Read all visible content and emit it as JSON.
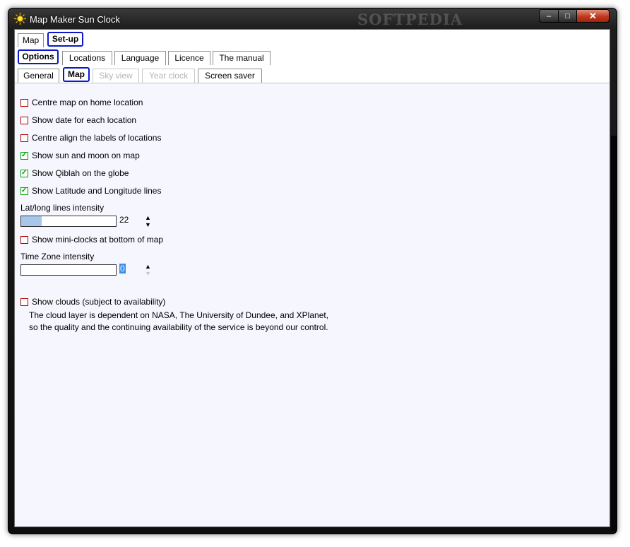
{
  "window": {
    "title": "Map Maker Sun Clock",
    "watermark": "SOFTPEDIA",
    "controls": {
      "minimize": "–",
      "maximize": "□",
      "close": "✕"
    }
  },
  "tabs_main": [
    {
      "label": "Map",
      "active": false
    },
    {
      "label": "Set-up",
      "active": true
    }
  ],
  "tabs_setup": [
    {
      "label": "Options",
      "active": true
    },
    {
      "label": "Locations",
      "active": false
    },
    {
      "label": "Language",
      "active": false
    },
    {
      "label": "Licence",
      "active": false
    },
    {
      "label": "The manual",
      "active": false
    }
  ],
  "tabs_options": [
    {
      "label": "General",
      "active": false,
      "enabled": true
    },
    {
      "label": "Map",
      "active": true,
      "enabled": true
    },
    {
      "label": "Sky view",
      "active": false,
      "enabled": false
    },
    {
      "label": "Year clock",
      "active": false,
      "enabled": false
    },
    {
      "label": "Screen saver",
      "active": false,
      "enabled": true
    }
  ],
  "options": [
    {
      "label": "Centre map on home location",
      "checked": false
    },
    {
      "label": "Show date for each location",
      "checked": false
    },
    {
      "label": "Centre align the labels of locations",
      "checked": false
    },
    {
      "label": "Show sun and moon on map",
      "checked": true
    },
    {
      "label": "Show Qiblah on the globe",
      "checked": true
    },
    {
      "label": "Show Latitude and Longitude lines",
      "checked": true
    }
  ],
  "latlong": {
    "label": "Lat/long lines intensity",
    "value": "22",
    "fraction": 0.22
  },
  "miniclocks": {
    "label": "Show mini-clocks at bottom of map",
    "checked": false
  },
  "timezone": {
    "label": "Time Zone intensity",
    "value": "0",
    "fraction": 0
  },
  "clouds": {
    "label": "Show clouds (subject to availability)",
    "checked": false
  },
  "cloud_note": [
    "The cloud layer is dependent on NASA, The University of Dundee, and XPlanet,",
    "so the quality and the continuing availability of the service is beyond our control."
  ],
  "colors": {
    "accent": "#0a18c8",
    "checked": "#00a000",
    "unchecked": "#b00000",
    "slider_fill": "#a7c7ea"
  }
}
